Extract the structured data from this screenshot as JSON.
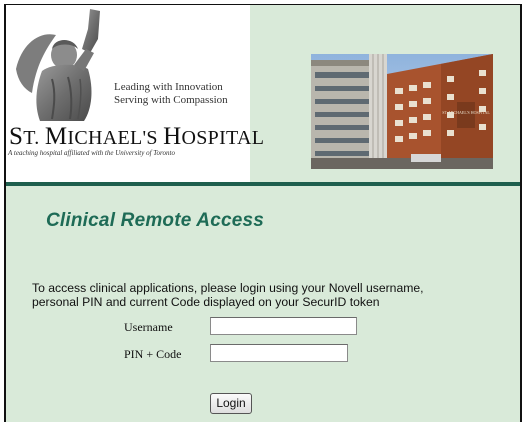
{
  "header": {
    "motto_line1": "Leading with Innovation",
    "motto_line2": "Serving with Compassion",
    "hospital_name_initial_1": "S",
    "hospital_name_part_1": "T. ",
    "hospital_name_initial_2": "M",
    "hospital_name_part_2": "ICHAEL'S ",
    "hospital_name_initial_3": "H",
    "hospital_name_part_3": "OSPITAL",
    "affiliation": "A teaching hospital affiliated with the University of Toronto",
    "photo_sign_text": "ST. MICHAEL'S HOSPITAL"
  },
  "main": {
    "title": "Clinical Remote Access",
    "intro_line1": "To access clinical applications, please login using your Novell username,",
    "intro_line2": "personal PIN and current Code displayed on your SecurID token",
    "username_label": "Username",
    "username_value": "",
    "pin_label": "PIN + Code",
    "pin_value": "",
    "login_button": "Login"
  },
  "colors": {
    "background": "#d9ead9",
    "divider": "#1e5f4e",
    "title": "#1e6b56"
  }
}
